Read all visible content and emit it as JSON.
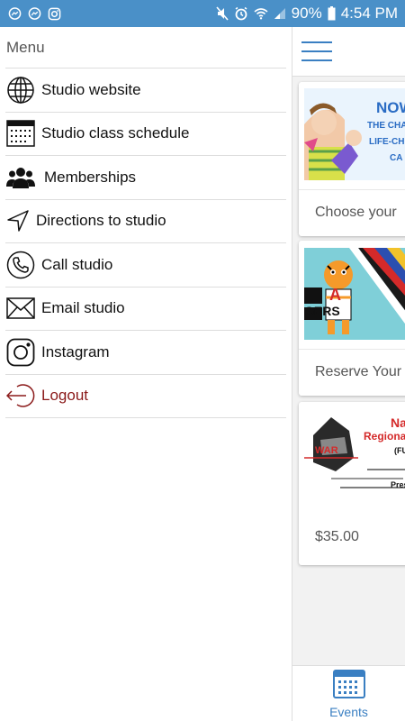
{
  "status_bar": {
    "left_icons": [
      "messenger-icon",
      "messenger-icon",
      "instagram-icon"
    ],
    "battery": "90%",
    "time": "4:54 PM"
  },
  "drawer": {
    "title": "Menu",
    "items": [
      {
        "label": "Studio website",
        "icon": "globe-icon"
      },
      {
        "label": "Studio class schedule",
        "icon": "calendar-icon"
      },
      {
        "label": "Memberships",
        "icon": "people-icon"
      },
      {
        "label": "Directions to studio",
        "icon": "navigation-icon"
      },
      {
        "label": "Call studio",
        "icon": "phone-icon"
      },
      {
        "label": "Email studio",
        "icon": "envelope-icon"
      },
      {
        "label": "Instagram",
        "icon": "instagram-icon"
      },
      {
        "label": "Logout",
        "icon": "logout-icon"
      }
    ]
  },
  "app": {
    "cards": [
      {
        "image_text": [
          "NOW",
          "THE CHA",
          "LIFE-CH",
          "CA"
        ],
        "text": "Choose your"
      },
      {
        "image_text": [
          "A",
          "GERS"
        ],
        "text": "Reserve Your"
      },
      {
        "image_text": [
          "Na",
          "Regiona",
          "(FU",
          "Presi"
        ],
        "text": "$35.00"
      }
    ],
    "bottom_nav": {
      "label": "Events"
    }
  },
  "colors": {
    "status_bar": "#4a90c8",
    "accent": "#3a7fc2",
    "logout": "#8b1a1a"
  }
}
